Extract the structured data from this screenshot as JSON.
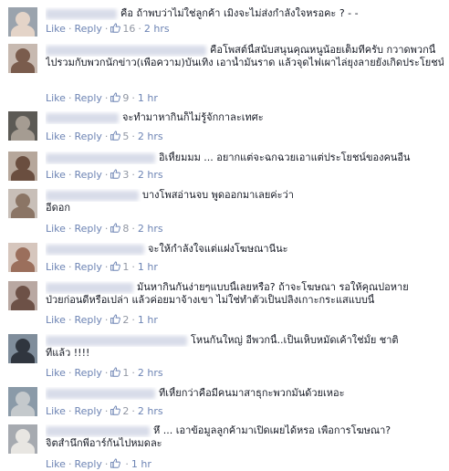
{
  "ui": {
    "like_label": "Like",
    "reply_label": "Reply",
    "dot": "·"
  },
  "comments": [
    {
      "author": "Muffy Noveffle",
      "text": "คือ ถ้าพบว่าไม่ใช่ลูกค้า เมิงจะไม่ส่งกำลังใจหรอคะ ? - -",
      "text2": "",
      "likes": "16",
      "time": "2 hrs",
      "avatar_bg": "#9aa3ad",
      "avatar_fg": "#e4d4c8"
    },
    {
      "author": "ยินจ้ายังนิตยลีกูนกลา ไรยาฯ",
      "text": "คือโพสต์นี้สนับสนุนคุณหนูน้อยเต็มที่ครับ กวาดพวกนี้",
      "text2": "ไปรวมกับพวกนักข่าว(เพื่อความ)บันเทิง เอาน้ำมันราด แล้วจุดไฟเผาไล่ยุงลายยังเกิดประโยชน์เสียกว่า",
      "likes": "9",
      "time": "1 hr",
      "avatar_bg": "#c7b9b0",
      "avatar_fg": "#7a5c4d"
    },
    {
      "author": "Somchai Sa",
      "text": "จะทำมาหากินก็ไม่รู้จักกาละเทศะ",
      "text2": "",
      "likes": "5",
      "time": "2 hrs",
      "avatar_bg": "#5c5a55",
      "avatar_fg": "#a59c92"
    },
    {
      "author": "Chantara Nuchkasame",
      "text": "อิเหี้ยมมม ... อยากแต่จะฉกฉวยเอาแต่ประโยชน์ของคนอื่น",
      "text2": "",
      "likes": "3",
      "time": "2 hrs",
      "avatar_bg": "#b6a79b",
      "avatar_fg": "#6a4e3f"
    },
    {
      "author": "Chonaim Tiphattai",
      "text": "บางโพสอ่านจบ พูดออกมาเลยค่ะว่า",
      "text2": "อีดอก",
      "likes": "8",
      "time": "2 hrs",
      "avatar_bg": "#c8bfb8",
      "avatar_fg": "#8b7565"
    },
    {
      "author": "Moorntaida Zooo",
      "text": "จะให้กำลังใจแต่แฝงโฆษณานี่นะ",
      "text2": "",
      "likes": "1",
      "time": "1 hr",
      "avatar_bg": "#d6c6bd",
      "avatar_fg": "#9b6f5c"
    },
    {
      "author": "Kanokwan Pantil",
      "text": "มันหากินกันง่ายๆแบบนี้เลยหรือ? ถ้าจะโฆษณา รอให้คุณปอหาย",
      "text2": "ป่วยก่อนดีหรือเปล่า แล้วค่อยมาจ้างเขา ไม่ใช่ทำตัวเป็นปลิงเกาะกระแสแบบนี้",
      "likes": "2",
      "time": "1 hr",
      "avatar_bg": "#b9a8a2",
      "avatar_fg": "#6d5147"
    },
    {
      "author": "Manaporn Tangchitthaworncha",
      "text": "โหนกันใหญ่ อีพวกนี้..เป็นเห็บหมัดเค้าใช่มั้ย ชาติ",
      "text2": "ที่แล้ว !!!!",
      "likes": "1",
      "time": "2 hrs",
      "avatar_bg": "#7f8d9b",
      "avatar_fg": "#30363f"
    },
    {
      "author": "Chatchai kn aram",
      "text": "ที่เหี้ยกว่าคือมีคนมาสาธุกะพวกมันด้วยเหอะ",
      "text2": "",
      "likes": "2",
      "time": "2 hrs",
      "avatar_bg": "#8a9aa8",
      "avatar_fg": "#c4c9cc"
    },
    {
      "author": "Soo Pehlsdasoodle",
      "text": "หึ ... เอาข้อมูลลูกค้ามาเปิดเผยได้หรอ เพื่อการโฆษณา?",
      "text2": "จิตสำนึกพีอาร์กันไปหมดละ",
      "likes": "",
      "time": "1 hr",
      "avatar_bg": "#a6aab0",
      "avatar_fg": "#e8e6e2"
    }
  ]
}
